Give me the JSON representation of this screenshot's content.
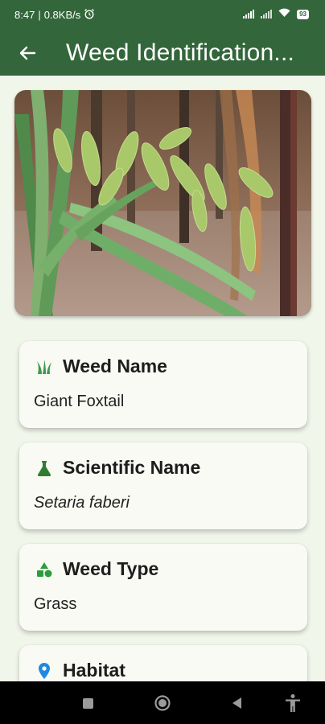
{
  "status_bar": {
    "time": "8:47",
    "speed": "0.8KB/s",
    "battery": "93",
    "icons": [
      "alarm-icon",
      "signal-icon",
      "wifi-icon",
      "battery-icon"
    ]
  },
  "app_bar": {
    "title": "Weed Identification...",
    "back_icon": "arrow-left-icon"
  },
  "image": {
    "subject": "giant-foxtail-photo"
  },
  "cards": [
    {
      "title": "Weed Name",
      "value": "Giant Foxtail",
      "icon": "grass-icon",
      "icon_color": "#3f9a4a",
      "italic": false
    },
    {
      "title": "Scientific Name",
      "value": "Setaria faberi",
      "icon": "flask-icon",
      "icon_color": "#2e7d32",
      "italic": true
    },
    {
      "title": "Weed Type",
      "value": "Grass",
      "icon": "category-icon",
      "icon_color": "#2e9b3f",
      "italic": false
    },
    {
      "title": "Habitat",
      "value": "",
      "icon": "location-pin-icon",
      "icon_color": "#1e88e5",
      "italic": false
    }
  ],
  "nav_bar": {
    "buttons": [
      "recents-button",
      "home-button",
      "back-button",
      "accessibility-button"
    ]
  },
  "colors": {
    "primary": "#33663a",
    "background": "#f1f6ea",
    "card": "#f8faf3"
  }
}
